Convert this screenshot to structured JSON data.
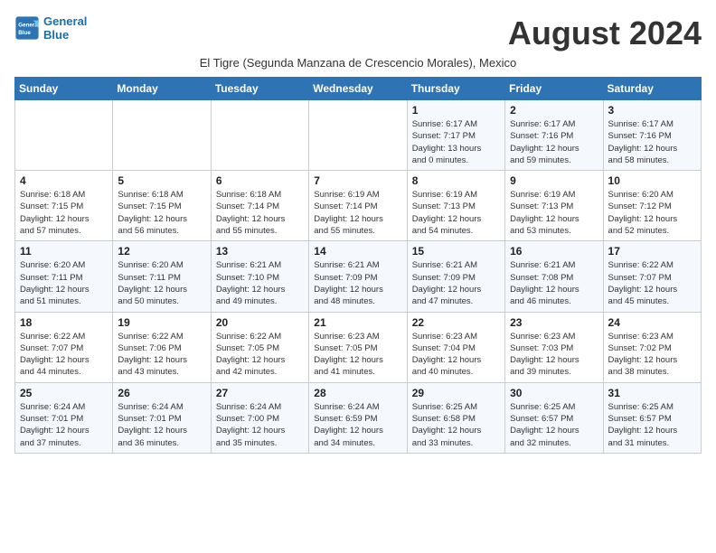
{
  "logo": {
    "line1": "General",
    "line2": "Blue"
  },
  "title": "August 2024",
  "subtitle": "El Tigre (Segunda Manzana de Crescencio Morales), Mexico",
  "days_header": [
    "Sunday",
    "Monday",
    "Tuesday",
    "Wednesday",
    "Thursday",
    "Friday",
    "Saturday"
  ],
  "weeks": [
    [
      {
        "day": "",
        "info": ""
      },
      {
        "day": "",
        "info": ""
      },
      {
        "day": "",
        "info": ""
      },
      {
        "day": "",
        "info": ""
      },
      {
        "day": "1",
        "info": "Sunrise: 6:17 AM\nSunset: 7:17 PM\nDaylight: 13 hours\nand 0 minutes."
      },
      {
        "day": "2",
        "info": "Sunrise: 6:17 AM\nSunset: 7:16 PM\nDaylight: 12 hours\nand 59 minutes."
      },
      {
        "day": "3",
        "info": "Sunrise: 6:17 AM\nSunset: 7:16 PM\nDaylight: 12 hours\nand 58 minutes."
      }
    ],
    [
      {
        "day": "4",
        "info": "Sunrise: 6:18 AM\nSunset: 7:15 PM\nDaylight: 12 hours\nand 57 minutes."
      },
      {
        "day": "5",
        "info": "Sunrise: 6:18 AM\nSunset: 7:15 PM\nDaylight: 12 hours\nand 56 minutes."
      },
      {
        "day": "6",
        "info": "Sunrise: 6:18 AM\nSunset: 7:14 PM\nDaylight: 12 hours\nand 55 minutes."
      },
      {
        "day": "7",
        "info": "Sunrise: 6:19 AM\nSunset: 7:14 PM\nDaylight: 12 hours\nand 55 minutes."
      },
      {
        "day": "8",
        "info": "Sunrise: 6:19 AM\nSunset: 7:13 PM\nDaylight: 12 hours\nand 54 minutes."
      },
      {
        "day": "9",
        "info": "Sunrise: 6:19 AM\nSunset: 7:13 PM\nDaylight: 12 hours\nand 53 minutes."
      },
      {
        "day": "10",
        "info": "Sunrise: 6:20 AM\nSunset: 7:12 PM\nDaylight: 12 hours\nand 52 minutes."
      }
    ],
    [
      {
        "day": "11",
        "info": "Sunrise: 6:20 AM\nSunset: 7:11 PM\nDaylight: 12 hours\nand 51 minutes."
      },
      {
        "day": "12",
        "info": "Sunrise: 6:20 AM\nSunset: 7:11 PM\nDaylight: 12 hours\nand 50 minutes."
      },
      {
        "day": "13",
        "info": "Sunrise: 6:21 AM\nSunset: 7:10 PM\nDaylight: 12 hours\nand 49 minutes."
      },
      {
        "day": "14",
        "info": "Sunrise: 6:21 AM\nSunset: 7:09 PM\nDaylight: 12 hours\nand 48 minutes."
      },
      {
        "day": "15",
        "info": "Sunrise: 6:21 AM\nSunset: 7:09 PM\nDaylight: 12 hours\nand 47 minutes."
      },
      {
        "day": "16",
        "info": "Sunrise: 6:21 AM\nSunset: 7:08 PM\nDaylight: 12 hours\nand 46 minutes."
      },
      {
        "day": "17",
        "info": "Sunrise: 6:22 AM\nSunset: 7:07 PM\nDaylight: 12 hours\nand 45 minutes."
      }
    ],
    [
      {
        "day": "18",
        "info": "Sunrise: 6:22 AM\nSunset: 7:07 PM\nDaylight: 12 hours\nand 44 minutes."
      },
      {
        "day": "19",
        "info": "Sunrise: 6:22 AM\nSunset: 7:06 PM\nDaylight: 12 hours\nand 43 minutes."
      },
      {
        "day": "20",
        "info": "Sunrise: 6:22 AM\nSunset: 7:05 PM\nDaylight: 12 hours\nand 42 minutes."
      },
      {
        "day": "21",
        "info": "Sunrise: 6:23 AM\nSunset: 7:05 PM\nDaylight: 12 hours\nand 41 minutes."
      },
      {
        "day": "22",
        "info": "Sunrise: 6:23 AM\nSunset: 7:04 PM\nDaylight: 12 hours\nand 40 minutes."
      },
      {
        "day": "23",
        "info": "Sunrise: 6:23 AM\nSunset: 7:03 PM\nDaylight: 12 hours\nand 39 minutes."
      },
      {
        "day": "24",
        "info": "Sunrise: 6:23 AM\nSunset: 7:02 PM\nDaylight: 12 hours\nand 38 minutes."
      }
    ],
    [
      {
        "day": "25",
        "info": "Sunrise: 6:24 AM\nSunset: 7:01 PM\nDaylight: 12 hours\nand 37 minutes."
      },
      {
        "day": "26",
        "info": "Sunrise: 6:24 AM\nSunset: 7:01 PM\nDaylight: 12 hours\nand 36 minutes."
      },
      {
        "day": "27",
        "info": "Sunrise: 6:24 AM\nSunset: 7:00 PM\nDaylight: 12 hours\nand 35 minutes."
      },
      {
        "day": "28",
        "info": "Sunrise: 6:24 AM\nSunset: 6:59 PM\nDaylight: 12 hours\nand 34 minutes."
      },
      {
        "day": "29",
        "info": "Sunrise: 6:25 AM\nSunset: 6:58 PM\nDaylight: 12 hours\nand 33 minutes."
      },
      {
        "day": "30",
        "info": "Sunrise: 6:25 AM\nSunset: 6:57 PM\nDaylight: 12 hours\nand 32 minutes."
      },
      {
        "day": "31",
        "info": "Sunrise: 6:25 AM\nSunset: 6:57 PM\nDaylight: 12 hours\nand 31 minutes."
      }
    ]
  ]
}
